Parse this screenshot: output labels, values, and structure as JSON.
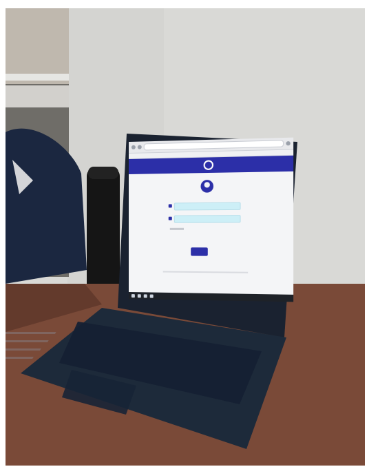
{
  "scene": {
    "description_visible": "",
    "laptop": {
      "screen": {
        "header_title": "",
        "login_button_label": ""
      }
    }
  },
  "colors": {
    "wall": "#d9d9d6",
    "desk": "#7a4a38",
    "laptop_body": "#1d2a3a",
    "screen_header": "#2c2fa8",
    "input_fill": "#cdeff7"
  },
  "icons": {
    "user_avatar": "user-icon",
    "field_icon": "user-field-icon"
  }
}
